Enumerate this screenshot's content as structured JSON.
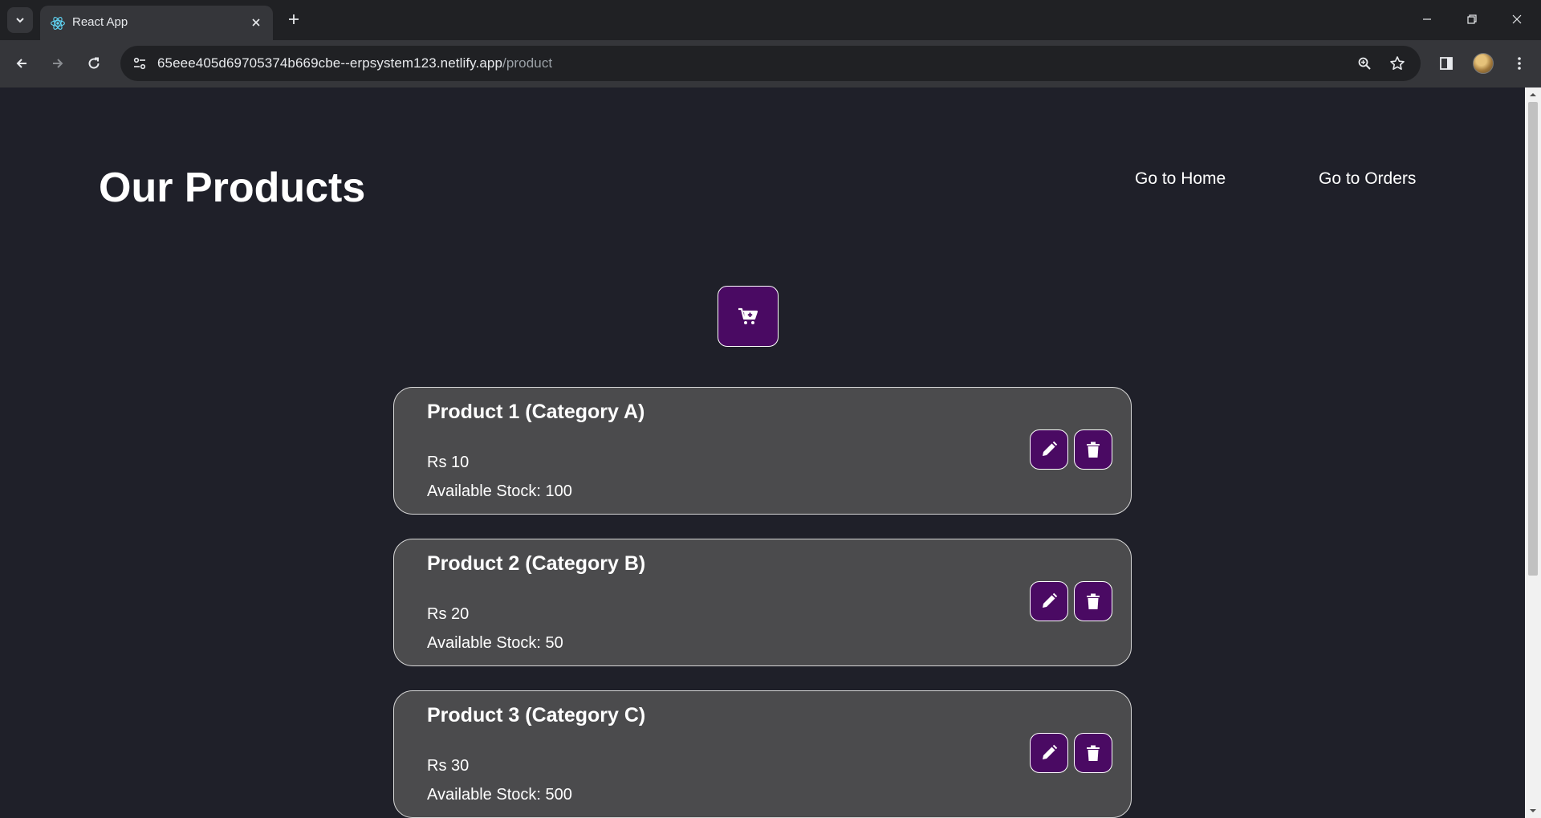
{
  "browser": {
    "tab_title": "React App",
    "url_host": "65eee405d69705374b669cbe--erpsystem123.netlify.app",
    "url_path": "/product"
  },
  "page": {
    "title": "Our Products",
    "nav": {
      "home_label": "Go to Home",
      "orders_label": "Go to Orders"
    },
    "accent_color": "#4a0a63",
    "card_color": "#4b4b4d",
    "background_color": "#1f2029"
  },
  "products": [
    {
      "name": "Product 1 (Category A)",
      "price": "Rs 10",
      "stock": "Available Stock: 100"
    },
    {
      "name": "Product 2 (Category B)",
      "price": "Rs 20",
      "stock": "Available Stock: 50"
    },
    {
      "name": "Product 3 (Category C)",
      "price": "Rs 30",
      "stock": "Available Stock: 500"
    }
  ],
  "icons": {
    "add_product": "add-to-cart-icon",
    "edit": "pencil-icon",
    "delete": "trash-icon"
  }
}
